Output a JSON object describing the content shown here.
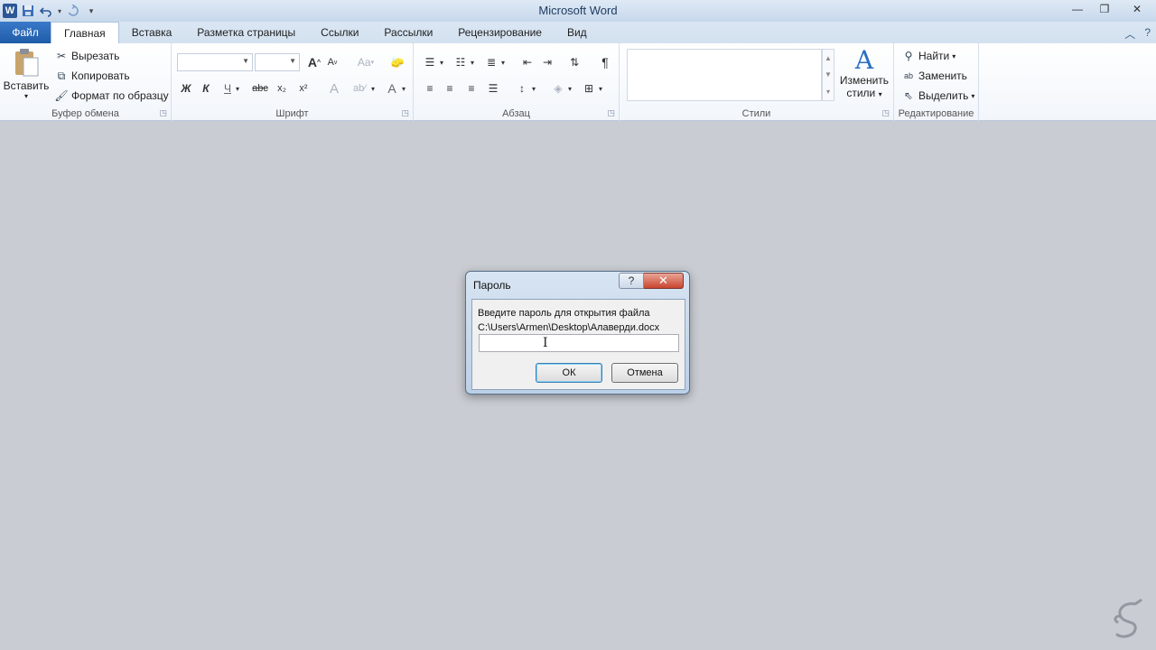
{
  "window": {
    "title": "Microsoft Word",
    "app_icon": "W"
  },
  "tabs": [
    {
      "label": "Файл"
    },
    {
      "label": "Главная"
    },
    {
      "label": "Вставка"
    },
    {
      "label": "Разметка страницы"
    },
    {
      "label": "Ссылки"
    },
    {
      "label": "Рассылки"
    },
    {
      "label": "Рецензирование"
    },
    {
      "label": "Вид"
    }
  ],
  "ribbon": {
    "clipboard": {
      "label": "Буфер обмена",
      "paste": "Вставить",
      "cut": "Вырезать",
      "copy": "Копировать",
      "format_painter": "Формат по образцу"
    },
    "font": {
      "label": "Шрифт",
      "bold": "Ж",
      "italic": "К",
      "underline": "Ч",
      "strike": "abc",
      "sub": "x₂",
      "sup": "x²",
      "grow": "A",
      "shrink": "A",
      "case": "Aa",
      "color": "A"
    },
    "paragraph": {
      "label": "Абзац",
      "pilcrow": "¶"
    },
    "styles": {
      "label": "Стили",
      "change_styles": "Изменить",
      "change_styles_2": "стили"
    },
    "editing": {
      "label": "Редактирование",
      "find": "Найти",
      "replace": "Заменить",
      "select": "Выделить"
    }
  },
  "dialog": {
    "title": "Пароль",
    "help": "?",
    "close": "✕",
    "prompt_line1": "Введите пароль для открытия файла",
    "prompt_line2": "C:\\Users\\Armen\\Desktop\\Алаверди.docx",
    "password_value": "",
    "ok": "ОК",
    "cancel": "Отмена"
  },
  "colors": {
    "accent": "#2b5797",
    "file_tab": "#1f5ca8",
    "close_button": "#c9452f",
    "workspace": "#c9ccd2"
  }
}
